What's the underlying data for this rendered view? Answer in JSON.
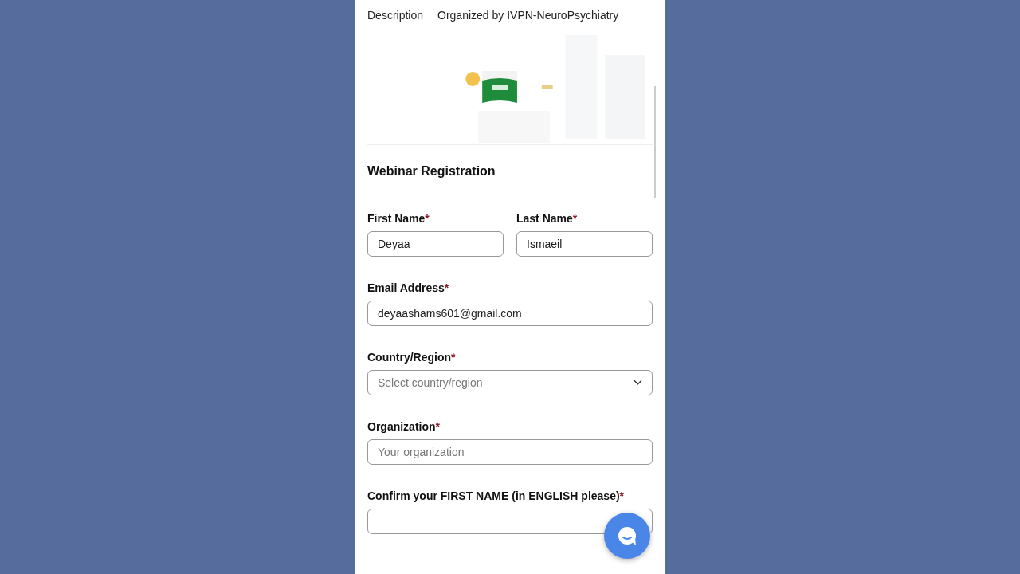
{
  "header": {
    "tab": "Description",
    "organizer": "Organized by IVPN-NeuroPsychiatry"
  },
  "form": {
    "title": "Webinar Registration",
    "rows": [
      [
        {
          "kind": "text",
          "label": "First Name",
          "required_mark": "*",
          "value": "Deyaa"
        },
        {
          "kind": "text",
          "label": "Last Name",
          "required_mark": "*",
          "value": "Ismaeil"
        }
      ],
      [
        {
          "kind": "text",
          "label": "Email Address",
          "required_mark": "*",
          "value": "deyaashams601@gmail.com"
        }
      ],
      [
        {
          "kind": "select",
          "label": "Country/Region",
          "required_mark": "*",
          "placeholder": "Select country/region"
        }
      ],
      [
        {
          "kind": "text",
          "label": "Organization",
          "required_mark": "*",
          "placeholder": "Your organization"
        }
      ],
      [
        {
          "kind": "text",
          "label": "Confirm your FIRST NAME (in ENGLISH please)",
          "required_mark": "*"
        }
      ]
    ]
  }
}
